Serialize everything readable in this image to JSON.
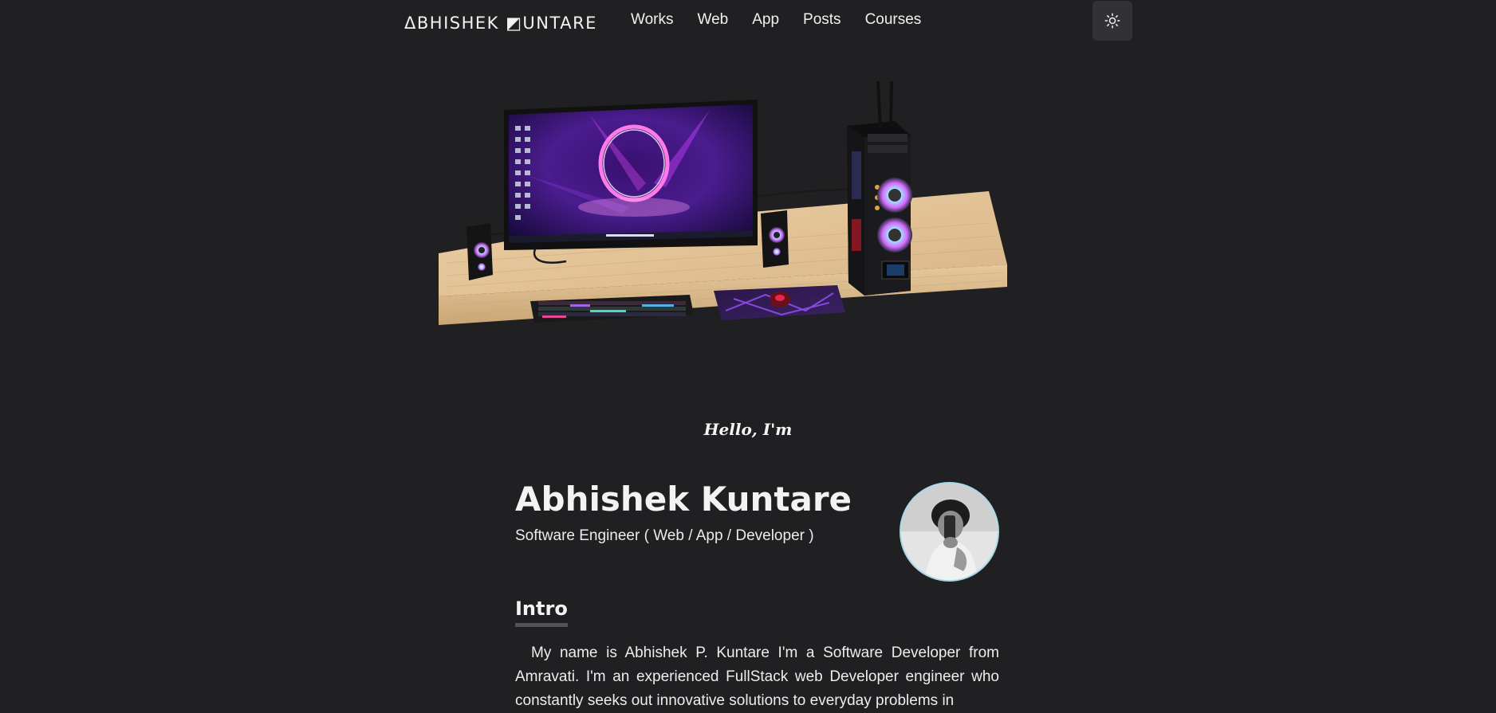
{
  "nav": {
    "logo": "ΔBHISHEK ◩UNTARE",
    "links": [
      "Works",
      "Web",
      "App",
      "Posts",
      "Courses"
    ],
    "theme_toggle_icon": "sun-icon"
  },
  "hero": {
    "scene_icon": "desk-setup-illustration"
  },
  "profile": {
    "greeting": "Hello, I'm",
    "name": "Abhishek Kuntare",
    "role": "Software Engineer ( Web / App / Developer )",
    "avatar_icon": "profile-photo"
  },
  "intro": {
    "title": "Intro",
    "text": "My name is Abhishek P. Kuntare I'm a Software Developer from Amravati. I'm an experienced FullStack web Developer engineer who constantly seeks out innovative solutions to everyday problems in"
  },
  "colors": {
    "background": "#202023",
    "text": "#ededed",
    "button_bg": "#323236",
    "avatar_border": "#a8d7ea",
    "desk_wood": "#e3c396"
  }
}
